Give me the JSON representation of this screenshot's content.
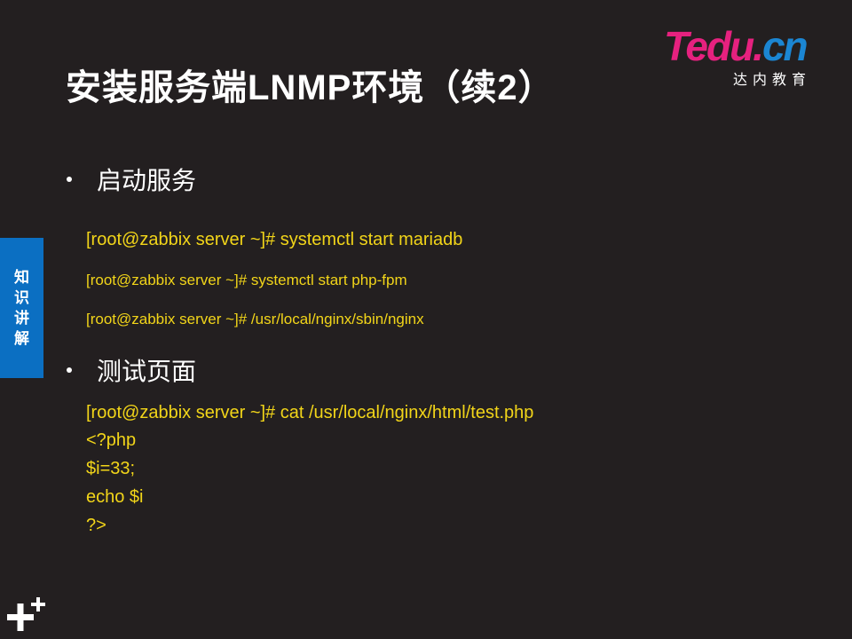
{
  "slide": {
    "title": "安装服务端LNMP环境（续2）",
    "logo": {
      "word_t": "T",
      "word_edu": "edu.",
      "word_cn": "cn",
      "subtitle": "达内教育"
    },
    "side_tab": {
      "chars": [
        "知",
        "识",
        "讲",
        "解"
      ]
    },
    "sections": [
      {
        "heading": "启动服务",
        "lines": [
          "[root@zabbix server ~]# systemctl start  mariadb",
          "[root@zabbix server ~]# systemctl start  php-fpm",
          "[root@zabbix server ~]# /usr/local/nginx/sbin/nginx"
        ]
      },
      {
        "heading": "测试页面",
        "lines": [
          "[root@zabbix server ~]# cat /usr/local/nginx/html/test.php",
          "<?php",
          "$i=33;",
          "echo $i",
          "?>"
        ]
      }
    ],
    "colors": {
      "background": "#231f20",
      "code_text": "#f2d519",
      "side_tab": "#0b6fc2",
      "logo_pink": "#e6217f",
      "logo_blue": "#1b86d3"
    }
  }
}
